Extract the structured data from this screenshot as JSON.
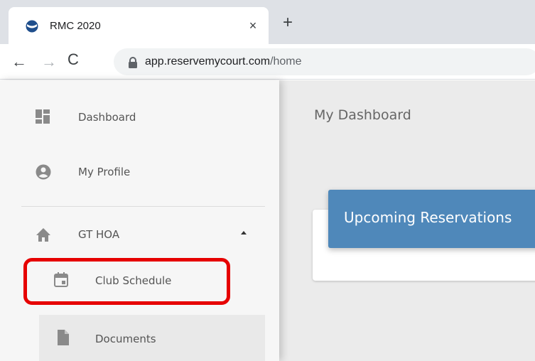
{
  "browser": {
    "tab_title": "RMC 2020",
    "tab_close_glyph": "×",
    "new_tab_glyph": "+",
    "url_host": "app.reservemycourt.com",
    "url_path": "/home",
    "back_glyph": "←",
    "forward_glyph": "→",
    "reload_glyph": "C"
  },
  "sidebar": {
    "items": [
      {
        "label": "Dashboard",
        "icon": "dashboard-icon"
      },
      {
        "label": "My Profile",
        "icon": "account-circle-icon"
      },
      {
        "label": "GT HOA",
        "icon": "home-icon",
        "expanded": true
      },
      {
        "label": "Club Schedule",
        "icon": "calendar-icon",
        "highlighted": true
      },
      {
        "label": "Documents",
        "icon": "document-icon"
      }
    ]
  },
  "main": {
    "title": "My Dashboard",
    "card_title": "Upcoming Reservations"
  },
  "colors": {
    "card_header": "#4f88ba",
    "highlight": "#e60000",
    "sidebar_bg": "#f6f6f6",
    "main_bg": "#ebebeb"
  }
}
